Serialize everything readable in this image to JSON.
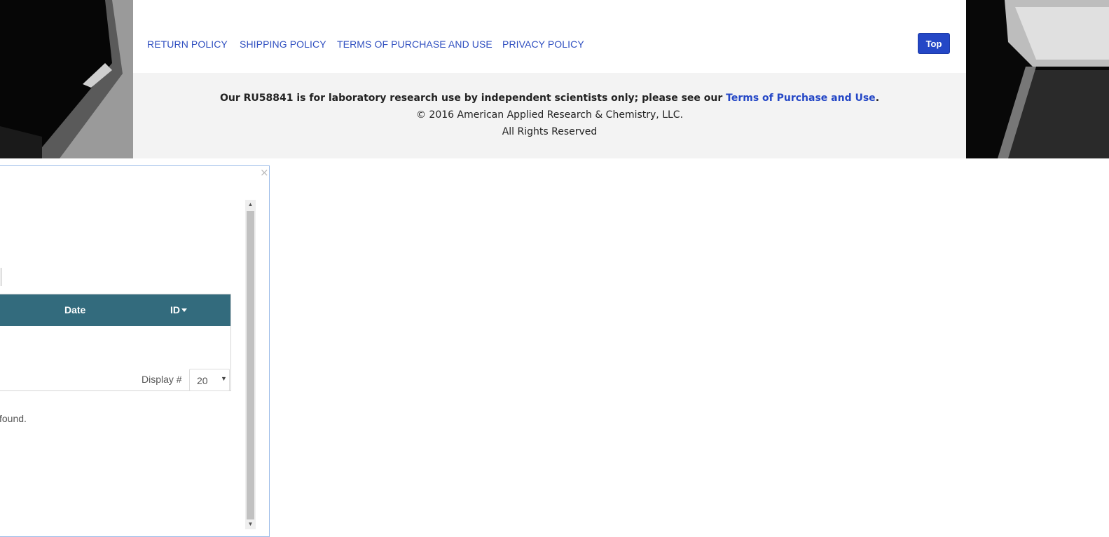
{
  "nav": {
    "links": [
      "RETURN POLICY",
      "SHIPPING POLICY",
      "TERMS OF PURCHASE AND USE",
      "PRIVACY POLICY"
    ],
    "top_button": "Top"
  },
  "footer": {
    "disclaimer_prefix": "Our RU58841 is for laboratory research use by independent scientists only; please see our ",
    "disclaimer_link": "Terms of Purchase and Use",
    "disclaimer_suffix": ".",
    "copyright": "© 2016 American Applied Research & Chemistry, LLC.",
    "rights": "All Rights Reserved"
  },
  "panel": {
    "close_symbol": "×",
    "table": {
      "columns": [
        "Date",
        "ID"
      ],
      "display_label": "Display #",
      "display_value": "20"
    },
    "empty_message": "found."
  },
  "colors": {
    "link": "#2f4fc0",
    "top_button": "#2447c6",
    "table_header": "#336b7d",
    "footer_bg": "#f3f3f3"
  }
}
